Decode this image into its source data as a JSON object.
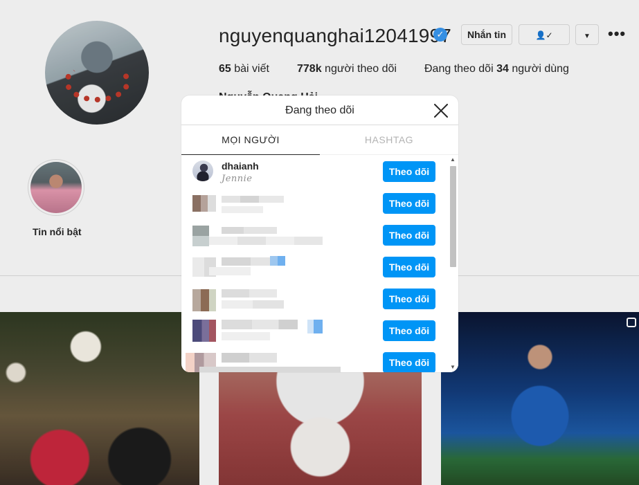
{
  "profile": {
    "username": "nguyenquanghai12041997",
    "verified_icon": "verified-badge-icon",
    "message_button": "Nhắn tin",
    "posts_count": "65",
    "posts_label": "bài viết",
    "followers_count": "778k",
    "followers_label": "người theo dõi",
    "following_prefix": "Đang theo dõi",
    "following_count": "34",
    "following_suffix": "người dùng",
    "real_name": "Nguyễn Quang Hải",
    "highlight_label": "Tin nổi bật"
  },
  "dialog": {
    "title": "Đang theo dõi",
    "close_icon": "close-icon",
    "tabs": [
      {
        "label": "MỌI NGƯỜI",
        "active": true
      },
      {
        "label": "HASHTAG",
        "active": false
      }
    ],
    "rows": [
      {
        "username": "dhaianh",
        "subtitle": "Jennie",
        "button": "Theo dõi"
      },
      {
        "username": "",
        "subtitle": "",
        "button": "Theo dõi"
      },
      {
        "username": "",
        "subtitle": "",
        "button": "Theo dõi"
      },
      {
        "username": "",
        "subtitle": "",
        "button": "Theo dõi"
      },
      {
        "username": "",
        "subtitle": "",
        "button": "Theo dõi"
      },
      {
        "username": "",
        "subtitle": "",
        "button": "Theo dõi"
      },
      {
        "username": "",
        "subtitle": "",
        "button": "Theo dõi"
      }
    ]
  },
  "colors": {
    "follow_button": "#0095f6",
    "verified": "#3897f0",
    "background": "#fafafa"
  }
}
